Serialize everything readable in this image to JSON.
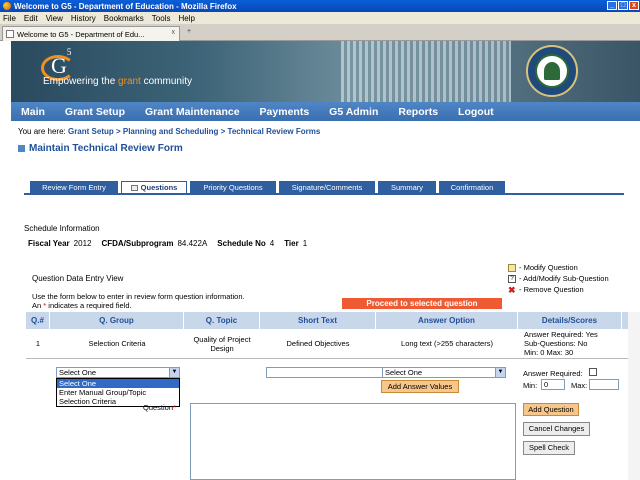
{
  "window": {
    "title": "Welcome to G5 - Department of Education - Mozilla Firefox",
    "controls": [
      "_",
      "□",
      "x"
    ]
  },
  "menubar": [
    "File",
    "Edit",
    "View",
    "History",
    "Bookmarks",
    "Tools",
    "Help"
  ],
  "browser_tab": {
    "label": "Welcome to G5 - Department of Edu...",
    "close": "x",
    "new_tab": "+"
  },
  "banner": {
    "logo": "G",
    "logo_sup": "5",
    "slogan_pre": "Empowering the ",
    "slogan_grant": "grant",
    "slogan_post": " community"
  },
  "mainnav": [
    "Main",
    "Grant Setup",
    "Grant Maintenance",
    "Payments",
    "G5 Admin",
    "Reports",
    "Logout"
  ],
  "breadcrumb": {
    "prefix": "You are here: ",
    "trail": "Grant Setup > Planning and Scheduling > Technical Review Forms"
  },
  "page_title": "Maintain Technical Review Form",
  "tabs": [
    "Review Form Entry",
    "Questions",
    "Priority Questions",
    "Signature/Comments",
    "Summary",
    "Confirmation"
  ],
  "schedule": {
    "heading": "Schedule Information",
    "fiscal_year_label": "Fiscal Year",
    "fiscal_year": "2012",
    "cfda_label": "CFDA/Subprogram",
    "cfda": "84.422A",
    "schedule_no_label": "Schedule No",
    "schedule_no": "4",
    "tier_label": "Tier",
    "tier": "1"
  },
  "qde": {
    "title": "Question Data Entry View",
    "instr1": "Use the form below to enter in review form question information.",
    "instr2_pre": "An ",
    "instr2_star": "*",
    "instr2_post": " indicates a required field."
  },
  "actions": [
    "- Modify Question",
    "- Add/Modify Sub-Question",
    "- Remove Question"
  ],
  "proceed_label": "Proceed to selected question",
  "table": {
    "headers": [
      "Q.#",
      "Q. Group",
      "Q. Topic",
      "Short Text",
      "Answer Option",
      "Details/Scores",
      "A"
    ],
    "row": {
      "num": "1",
      "group": "Selection Criteria",
      "topic": "Quality of Project Design",
      "short": "Defined Objectives",
      "answer": "Long text (>255 characters)",
      "details1": "Answer Required: Yes",
      "details2": "Sub-Questions: No",
      "details3": "Min: 0 Max: 30"
    }
  },
  "form": {
    "group_select": "Select One",
    "group_options": [
      "Select One",
      "Enter Manual Group/Topic",
      "Selection Criteria"
    ],
    "answer_select": "Select One",
    "add_answer_values": "Add Answer Values",
    "answer_required_label": "Answer Required:",
    "min_label": "Min:",
    "min_value": "0",
    "max_label": "Max:",
    "question_label": "Question",
    "question_star": "*",
    "add_question": "Add Question",
    "cancel_changes": "Cancel Changes",
    "spell_check": "Spell Check"
  }
}
